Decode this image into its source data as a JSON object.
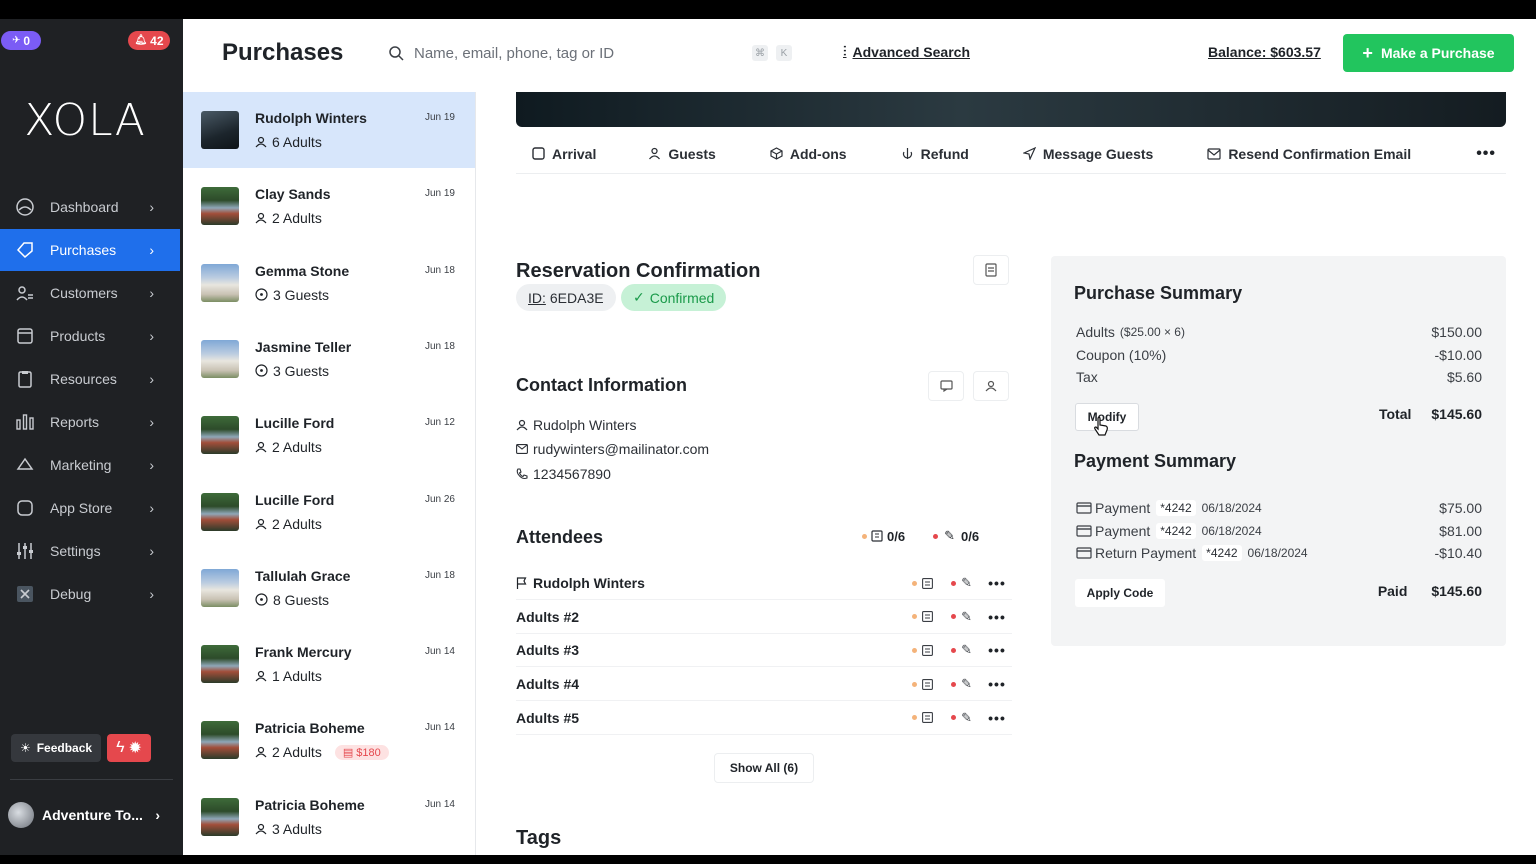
{
  "sidebar": {
    "notif_left": "0",
    "notif_right": "42",
    "logo": "XOLA",
    "nav": [
      {
        "label": "Dashboard",
        "icon": "dashboard-icon",
        "active": false
      },
      {
        "label": "Purchases",
        "icon": "tag-icon",
        "active": true
      },
      {
        "label": "Customers",
        "icon": "users-icon",
        "active": false
      },
      {
        "label": "Products",
        "icon": "box-icon",
        "active": false
      },
      {
        "label": "Resources",
        "icon": "clipboard-icon",
        "active": false
      },
      {
        "label": "Reports",
        "icon": "bar-chart-icon",
        "active": false
      },
      {
        "label": "Marketing",
        "icon": "megaphone-icon",
        "active": false
      },
      {
        "label": "App Store",
        "icon": "square-icon",
        "active": false
      },
      {
        "label": "Settings",
        "icon": "sliders-icon",
        "active": false
      },
      {
        "label": "Debug",
        "icon": "x-box-icon",
        "active": false
      }
    ],
    "feedback_label": "Feedback",
    "account_name": "Adventure To..."
  },
  "topbar": {
    "title": "Purchases",
    "search_placeholder": "Name, email, phone, tag or ID",
    "kbd1": "⌘",
    "kbd2": "K",
    "advanced_search": "Advanced Search",
    "balance": "Balance: $603.57",
    "make_purchase": "Make a Purchase"
  },
  "purchases": [
    {
      "name": "Rudolph Winters",
      "sub": "6 Adults",
      "date": "Jun 19",
      "thumb": "dark",
      "icon": "person",
      "selected": true
    },
    {
      "name": "Clay Sands",
      "sub": "2 Adults",
      "date": "Jun 19",
      "thumb": "river",
      "icon": "person"
    },
    {
      "name": "Gemma Stone",
      "sub": "3 Guests",
      "date": "Jun 18",
      "thumb": "build",
      "icon": "clock"
    },
    {
      "name": "Jasmine Teller",
      "sub": "3 Guests",
      "date": "Jun 18",
      "thumb": "build",
      "icon": "clock"
    },
    {
      "name": "Lucille Ford",
      "sub": "2 Adults",
      "date": "Jun 12",
      "thumb": "river",
      "icon": "person"
    },
    {
      "name": "Lucille Ford",
      "sub": "2 Adults",
      "date": "Jun 26",
      "thumb": "river",
      "icon": "person"
    },
    {
      "name": "Tallulah Grace",
      "sub": "8 Guests",
      "date": "Jun 18",
      "thumb": "build",
      "icon": "clock"
    },
    {
      "name": "Frank Mercury",
      "sub": "1 Adults",
      "date": "Jun 14",
      "thumb": "river",
      "icon": "person"
    },
    {
      "name": "Patricia Boheme",
      "sub": "2 Adults",
      "date": "Jun 14",
      "thumb": "river",
      "icon": "person",
      "badge": "$180"
    },
    {
      "name": "Patricia Boheme",
      "sub": "3 Adults",
      "date": "Jun 14",
      "thumb": "river",
      "icon": "person"
    }
  ],
  "actions": [
    "Arrival",
    "Guests",
    "Add-ons",
    "Refund",
    "Message Guests",
    "Resend Confirmation Email"
  ],
  "reservation": {
    "title": "Reservation Confirmation",
    "id_label": "ID:",
    "id_value": "6EDA3E",
    "status": "Confirmed"
  },
  "contact": {
    "title": "Contact Information",
    "name": "Rudolph Winters",
    "email": "rudywinters@mailinator.com",
    "phone": "1234567890"
  },
  "attendees": {
    "title": "Attendees",
    "count_forms": "0/6",
    "count_waivers": "0/6",
    "rows": [
      "Rudolph Winters",
      "Adults #2",
      "Adults #3",
      "Adults #4",
      "Adults #5"
    ],
    "show_all": "Show All (6)"
  },
  "tags_title": "Tags",
  "purchase_summary": {
    "title": "Purchase Summary",
    "adults_label": "Adults",
    "adults_detail": "($25.00 × 6)",
    "adults_amount": "$150.00",
    "coupon_label": "Coupon (10%)",
    "coupon_amount": "-$10.00",
    "tax_label": "Tax",
    "tax_amount": "$5.60",
    "modify": "Modify",
    "total_label": "Total",
    "total_amount": "$145.60"
  },
  "payment_summary": {
    "title": "Payment Summary",
    "rows": [
      {
        "label": "Payment",
        "card": "*4242",
        "date": "06/18/2024",
        "amount": "$75.00"
      },
      {
        "label": "Payment",
        "card": "*4242",
        "date": "06/18/2024",
        "amount": "$81.00"
      },
      {
        "label": "Return Payment",
        "card": "*4242",
        "date": "06/18/2024",
        "amount": "-$10.40"
      }
    ],
    "apply_code": "Apply Code",
    "paid_label": "Paid",
    "paid_amount": "$145.60"
  },
  "colors": {
    "accent": "#1f6feb",
    "primary_button": "#22c55e",
    "sidebar_bg": "#1f2124",
    "danger": "#e5484d"
  }
}
